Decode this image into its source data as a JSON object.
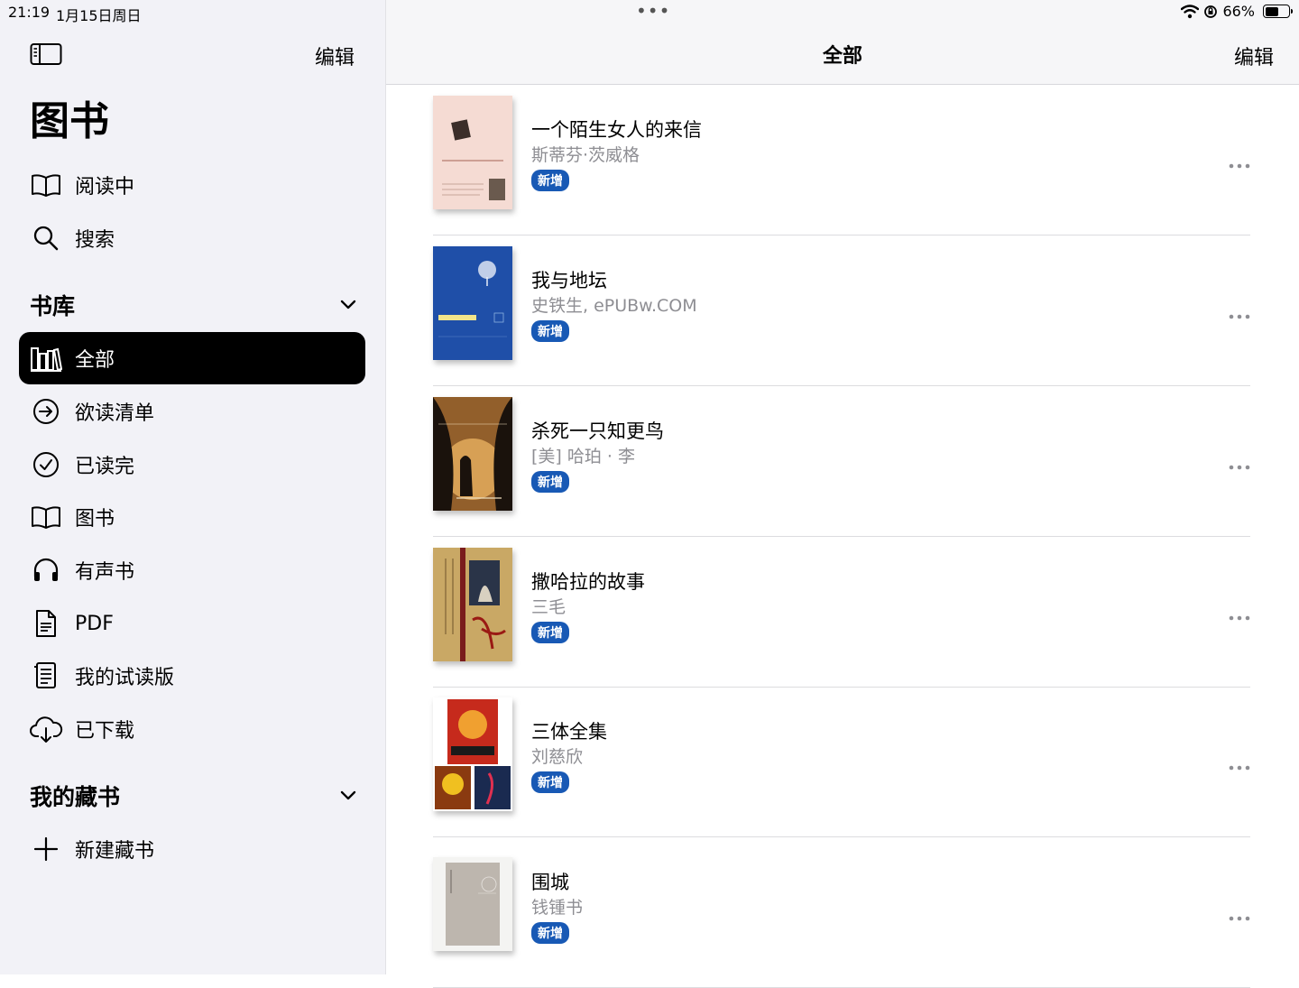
{
  "status": {
    "time": "21:19",
    "date": "1月15日周日",
    "battery": "66%",
    "battery_level": 0.66,
    "dots": "•••"
  },
  "sidebar": {
    "edit_label": "编辑",
    "title": "图书",
    "top_items": [
      {
        "label": "阅读中",
        "icon": "book-open-icon"
      },
      {
        "label": "搜索",
        "icon": "search-icon"
      }
    ],
    "library_section": "书库",
    "library_items": [
      {
        "label": "全部",
        "icon": "books-icon",
        "selected": true
      },
      {
        "label": "欲读清单",
        "icon": "arrow-circle-icon"
      },
      {
        "label": "已读完",
        "icon": "checkmark-circle-icon"
      },
      {
        "label": "图书",
        "icon": "book-open-icon"
      },
      {
        "label": "有声书",
        "icon": "headphones-icon"
      },
      {
        "label": "PDF",
        "icon": "document-icon"
      },
      {
        "label": "我的试读版",
        "icon": "sample-icon"
      },
      {
        "label": "已下载",
        "icon": "cloud-download-icon"
      }
    ],
    "collections_section": "我的藏书",
    "new_collection": "新建藏书"
  },
  "main": {
    "title": "全部",
    "edit_label": "编辑",
    "books": [
      {
        "title": "一个陌生女人的来信",
        "author": "斯蒂芬·茨威格",
        "badge": "新增",
        "cover_color": "#f2cfc4"
      },
      {
        "title": "我与地坛",
        "author": "史铁生, ePUBw.COM",
        "badge": "新增",
        "cover_color": "#1f4fa8"
      },
      {
        "title": "杀死一只知更鸟",
        "author": "[美] 哈珀 · 李",
        "badge": "新增",
        "cover_color": "#c9843a"
      },
      {
        "title": "撒哈拉的故事",
        "author": "三毛",
        "badge": "新增",
        "cover_color": "#c9a865"
      },
      {
        "title": "三体全集",
        "author": "刘慈欣",
        "badge": "新增",
        "cover_color": "#c62a1c"
      },
      {
        "title": "围城",
        "author": "钱锺书",
        "badge": "新增",
        "cover_color": "#bdb6ae"
      }
    ]
  },
  "colors": {
    "accent_black": "#000000",
    "badge_blue": "#1859b5",
    "sidebar_bg": "#f2f2f7"
  }
}
